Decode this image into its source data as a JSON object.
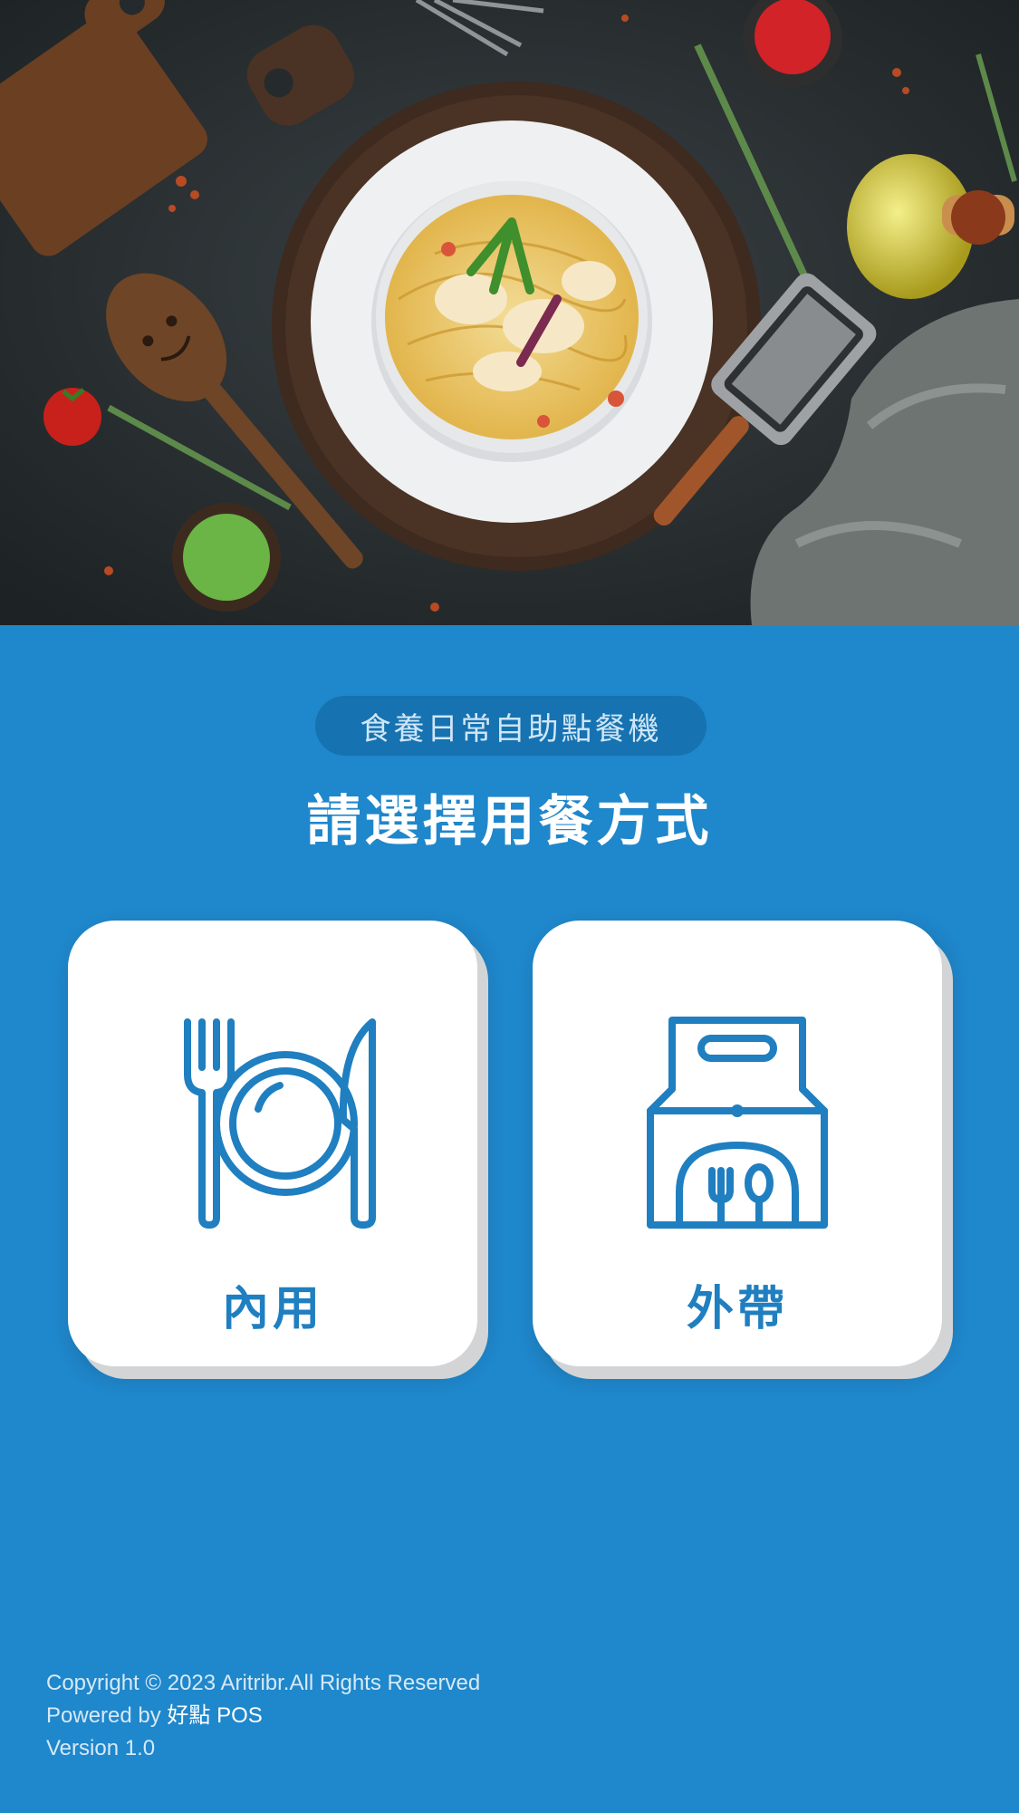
{
  "kiosk_name": "食養日常自助點餐機",
  "prompt_title": "請選擇用餐方式",
  "options": [
    {
      "label": "內用",
      "icon": "plate-fork-knife-icon"
    },
    {
      "label": "外帶",
      "icon": "takeaway-bag-icon"
    }
  ],
  "footer": {
    "copyright": "Copyright © 2023 Aritribr.All Rights Reserved",
    "powered_prefix": "Powered by ",
    "powered_brand": "好點 POS",
    "version": "Version 1.0"
  },
  "colors": {
    "background": "#1f87cb",
    "pill": "#1672b0",
    "card": "#ffffff",
    "accent": "#1f7fc0"
  }
}
